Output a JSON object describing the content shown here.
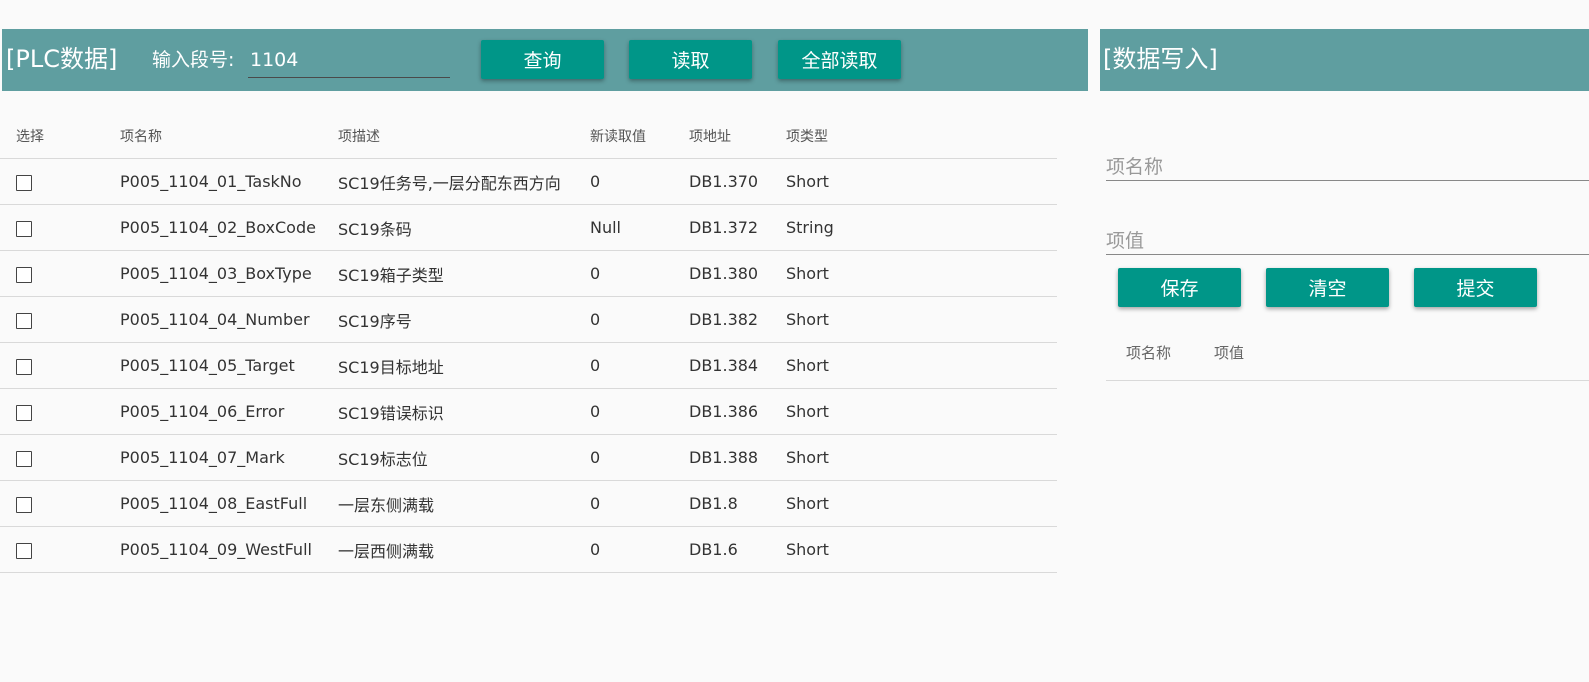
{
  "plc": {
    "title": "[PLC数据]",
    "segment_label": "输入段号:",
    "segment_value": "1104",
    "buttons": {
      "query": "查询",
      "read": "读取",
      "read_all": "全部读取"
    }
  },
  "table": {
    "headers": [
      "选择",
      "项名称",
      "项描述",
      "新读取值",
      "项地址",
      "项类型"
    ],
    "rows": [
      {
        "name": "P005_1104_01_TaskNo",
        "desc": "SC19任务号,一层分配东西方向",
        "value": "0",
        "addr": "DB1.370",
        "type": "Short"
      },
      {
        "name": "P005_1104_02_BoxCode",
        "desc": "SC19条码",
        "value": "Null",
        "addr": "DB1.372",
        "type": "String"
      },
      {
        "name": "P005_1104_03_BoxType",
        "desc": "SC19箱子类型",
        "value": "0",
        "addr": "DB1.380",
        "type": "Short"
      },
      {
        "name": "P005_1104_04_Number",
        "desc": "SC19序号",
        "value": "0",
        "addr": "DB1.382",
        "type": "Short"
      },
      {
        "name": "P005_1104_05_Target",
        "desc": "SC19目标地址",
        "value": "0",
        "addr": "DB1.384",
        "type": "Short"
      },
      {
        "name": "P005_1104_06_Error",
        "desc": "SC19错误标识",
        "value": "0",
        "addr": "DB1.386",
        "type": "Short"
      },
      {
        "name": "P005_1104_07_Mark",
        "desc": "SC19标志位",
        "value": "0",
        "addr": "DB1.388",
        "type": "Short"
      },
      {
        "name": "P005_1104_08_EastFull",
        "desc": "一层东侧满载",
        "value": "0",
        "addr": "DB1.8",
        "type": "Short"
      },
      {
        "name": "P005_1104_09_WestFull",
        "desc": "一层西侧满载",
        "value": "0",
        "addr": "DB1.6",
        "type": "Short"
      }
    ]
  },
  "write": {
    "title": "[数据写入]",
    "name_placeholder": "项名称",
    "value_placeholder": "项值",
    "buttons": {
      "save": "保存",
      "clear": "清空",
      "submit": "提交"
    },
    "list_headers": {
      "name": "项名称",
      "value": "项值"
    }
  },
  "colors": {
    "header_bar": "#5f9ea0",
    "button": "#009688"
  }
}
